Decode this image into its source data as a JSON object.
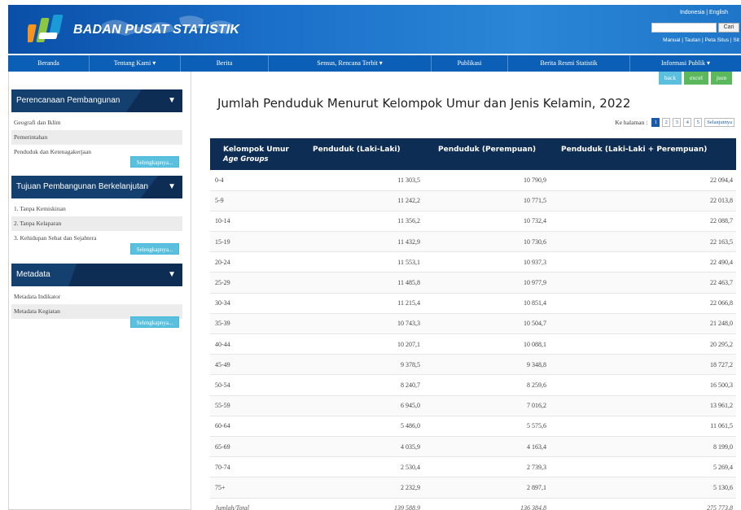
{
  "header": {
    "brand": "BADAN PUSAT STATISTIK",
    "lang_links": "Indonesia | English",
    "search_button": "Cari",
    "top_links": "Manual | Tautan | Peta Situs | Sit"
  },
  "nav": {
    "items": [
      {
        "label": "Beranda"
      },
      {
        "label": "Tentang Kami ▾"
      },
      {
        "label": "Berita"
      },
      {
        "label": "Sensus, Rencana Terbit ▾"
      },
      {
        "label": "Publikasi"
      },
      {
        "label": "Berita Resmi Statistik"
      },
      {
        "label": "Informasi Publik ▾"
      }
    ]
  },
  "actions": {
    "back": "back",
    "excel": "excel",
    "json": "json"
  },
  "sidebar": {
    "more_label": "Selengkapnya...",
    "panels": [
      {
        "title": "Perencanaan Pembangunan",
        "items": [
          "Geografi dan Iklim",
          "Pemerintahan",
          "Penduduk dan Ketenagakerjaan"
        ]
      },
      {
        "title": "Tujuan Pembangunan Berkelanjutan",
        "items": [
          "1. Tanpa Kemiskinan",
          "2. Tanpa Kelaparan",
          "3. Kehidupan Sehat dan Sejahtera"
        ]
      },
      {
        "title": "Metadata",
        "items": [
          "Metadata Indikator",
          "Metadata Kegiatan"
        ]
      }
    ]
  },
  "page": {
    "title": "Jumlah Penduduk Menurut Kelompok Umur dan Jenis Kelamin, 2022",
    "pager_label": "Ke halaman :",
    "pages": [
      "1",
      "2",
      "3",
      "4",
      "5"
    ],
    "next_label": "Selanjutnya"
  },
  "table": {
    "headers": {
      "age": "Kelompok Umur",
      "age_sub": "Age Groups",
      "male": "Penduduk (Laki-Laki)",
      "female": "Penduduk (Perempuan)",
      "total": "Penduduk (Laki-Laki + Perempuan)"
    },
    "rows": [
      [
        "0-4",
        "11 303,5",
        "10 790,9",
        "22 094,4"
      ],
      [
        "5-9",
        "11 242,2",
        "10 771,5",
        "22 013,8"
      ],
      [
        "10-14",
        "11 356,2",
        "10 732,4",
        "22 088,7"
      ],
      [
        "15-19",
        "11 432,9",
        "10 730,6",
        "22 163,5"
      ],
      [
        "20-24",
        "11 553,1",
        "10 937,3",
        "22 490,4"
      ],
      [
        "25-29",
        "11 485,8",
        "10 977,9",
        "22 463,7"
      ],
      [
        "30-34",
        "11 215,4",
        "10 851,4",
        "22 066,8"
      ],
      [
        "35-39",
        "10 743,3",
        "10 504,7",
        "21 248,0"
      ],
      [
        "40-44",
        "10 207,1",
        "10 088,1",
        "20 295,2"
      ],
      [
        "45-49",
        "9 378,5",
        "9 348,8",
        "18 727,2"
      ],
      [
        "50-54",
        "8 240,7",
        "8 259,6",
        "16 500,3"
      ],
      [
        "55-59",
        "6 945,0",
        "7 016,2",
        "13 961,2"
      ],
      [
        "60-64",
        "5 486,0",
        "5 575,6",
        "11 061,5"
      ],
      [
        "65-69",
        "4 035,9",
        "4 163,4",
        "8 199,0"
      ],
      [
        "70-74",
        "2 530,4",
        "2 739,3",
        "5 269,4"
      ],
      [
        "75+",
        "2 232,9",
        "2 897,1",
        "5 130,6"
      ]
    ],
    "total": [
      "Jumlah/Total",
      "139 588,9",
      "136 384,8",
      "275 773,8"
    ]
  },
  "colors": {
    "header_blue": "#1a6fc8",
    "nav_blue": "#0c5fb6",
    "panel_navy": "#0d2d55",
    "btn_cyan": "#5bc0de",
    "btn_green": "#5cb85c"
  }
}
